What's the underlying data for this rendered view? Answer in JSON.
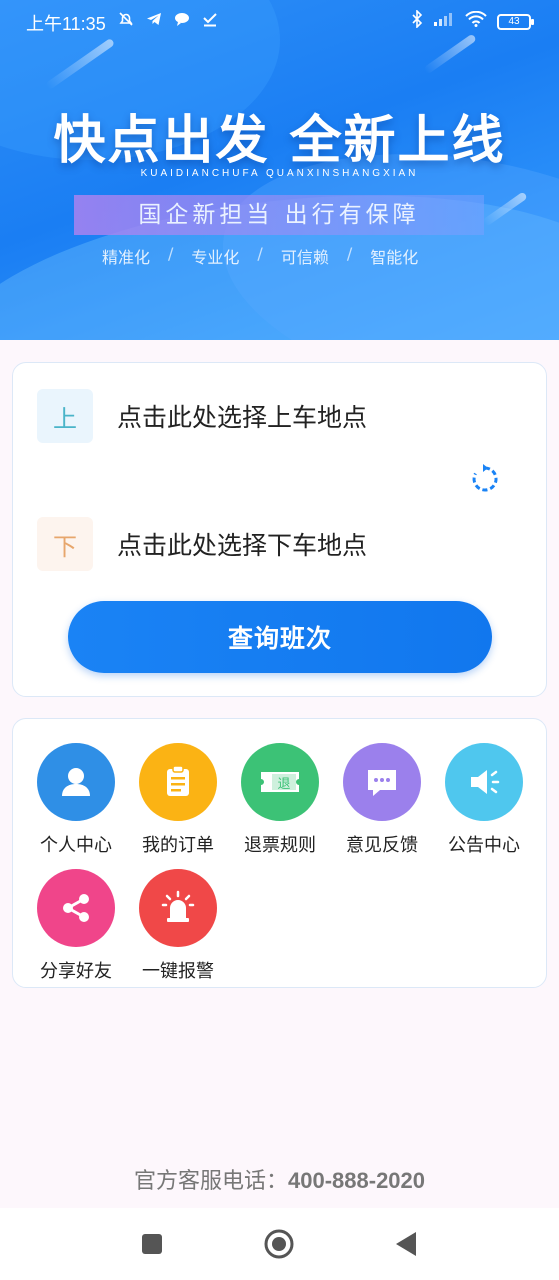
{
  "status_bar": {
    "time": "上午11:35",
    "battery": "43",
    "icons": [
      "alarm-off-icon",
      "telegram-icon",
      "chat-icon",
      "checkmark-icon",
      "bluetooth-icon",
      "signal-icon",
      "wifi-icon",
      "battery-icon"
    ]
  },
  "banner": {
    "headline": "快点出发  全新上线",
    "pinyin": "KUAIDIANCHUFA  QUANXINSHANGXIAN",
    "slogan": "国企新担当 出行有保障",
    "tags": [
      "精准化",
      "专业化",
      "可信赖",
      "智能化"
    ],
    "tag_separator": "/"
  },
  "route": {
    "pickup_badge": "上",
    "pickup_text": "点击此处选择上车地点",
    "dropoff_badge": "下",
    "dropoff_text": "点击此处选择下车地点",
    "swap_icon": "swap-icon",
    "query_button": "查询班次"
  },
  "menu": {
    "items": [
      {
        "label": "个人中心",
        "icon": "user-icon",
        "color": "#2f8fe6"
      },
      {
        "label": "我的订单",
        "icon": "clipboard-icon",
        "color": "#fbb314"
      },
      {
        "label": "退票规则",
        "icon": "ticket-refund-icon",
        "color": "#3cc276"
      },
      {
        "label": "意见反馈",
        "icon": "message-icon",
        "color": "#9b80ec"
      },
      {
        "label": "公告中心",
        "icon": "speaker-icon",
        "color": "#4fc7ee"
      },
      {
        "label": "分享好友",
        "icon": "share-icon",
        "color": "#f0458a"
      },
      {
        "label": "一键报警",
        "icon": "alarm-siren-icon",
        "color": "#f04848"
      }
    ]
  },
  "footer": {
    "hotline_label": "官方客服电话：",
    "hotline_number": "400-888-2020"
  },
  "navbar": {
    "buttons": [
      "recent-apps-icon",
      "home-icon",
      "back-icon"
    ]
  }
}
